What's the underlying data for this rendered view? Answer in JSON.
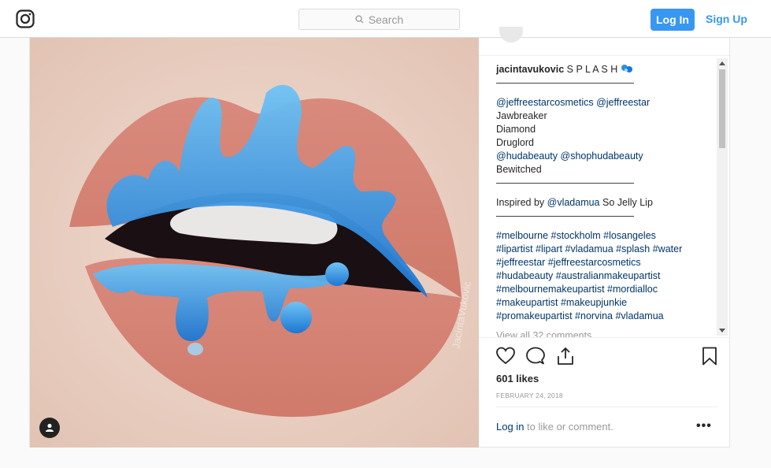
{
  "header": {
    "logo_icon": "instagram-icon",
    "search_placeholder": "Search",
    "login_label": "Log In",
    "signup_label": "Sign Up"
  },
  "post": {
    "username": "jacintavukovic",
    "caption_lines": [
      {
        "text": "——————————————",
        "style": "plain"
      },
      {
        "gap": true
      },
      {
        "text": "@jeffreestarcosmetics @jeffreestar",
        "style": "blue"
      },
      {
        "text": "Jawbreaker",
        "style": "plain"
      },
      {
        "text": "Diamond",
        "style": "plain"
      },
      {
        "text": "Druglord",
        "style": "plain"
      },
      {
        "text": "@hudabeauty @shophudabeauty",
        "style": "blue"
      },
      {
        "text": "Bewitched",
        "style": "plain"
      },
      {
        "text": "——————————————",
        "style": "plain"
      },
      {
        "gap": true
      },
      {
        "text_prefix": "Inspired by ",
        "text_link": "@vladamua",
        "text_suffix": " So Jelly Lip",
        "style": "mixed"
      },
      {
        "text": "——————————————",
        "style": "plain"
      },
      {
        "gap": true
      },
      {
        "text": "#melbourne #stockholm #losangeles",
        "style": "blue"
      },
      {
        "text": "#lipartist #lipart #vladamua #splash #water",
        "style": "blue"
      },
      {
        "text": "#jeffreestar #jeffreestarcosmetics",
        "style": "blue"
      },
      {
        "text": "#hudabeauty #australianmakeupartist",
        "style": "blue"
      },
      {
        "text": "#melbournemakeupartist #mordialloc",
        "style": "blue"
      },
      {
        "text": "#makeupartist #makeupjunkie",
        "style": "blue"
      },
      {
        "text": "#promakeupartist #norvina #vladamua",
        "style": "blue"
      }
    ],
    "caption_title": "S P L A S H",
    "view_comments": "View all 32 comments",
    "likes": "601 likes",
    "date": "FEBRUARY 24, 2018",
    "footer_login": "Log in",
    "footer_text": " to like or comment.",
    "more_label": "•••",
    "watermark": "JacintaVukovic",
    "user_tag_icon": "user-icon"
  },
  "colors": {
    "accent": "#3897f0",
    "link": "#003569",
    "lip": "#d7867a",
    "splash": "#2f8fe0"
  }
}
